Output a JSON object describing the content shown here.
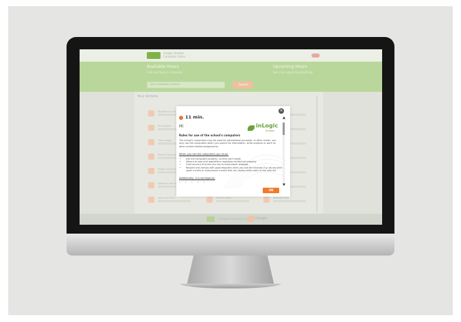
{
  "site": {
    "app_name": "inLogic Studios",
    "topbar_sub": "Computer Rules",
    "hero_title": "Available Hours",
    "hero_subtitle": "Find and book a computer",
    "hero_right_title": "Upcoming Hours",
    "hero_right_sub": "See your upcoming bookings",
    "search_placeholder": "Type a keyword to search",
    "search_button": "Search",
    "section_title": "Your Actions",
    "tiles": [
      {
        "title": "Register an hour",
        "sub": "Book a computer"
      },
      {
        "title": "Change your password",
        "sub": "Update account"
      },
      {
        "title": "My hours",
        "sub": "View schedule"
      },
      {
        "title": "Print labels",
        "sub": "Printer options"
      },
      {
        "title": "Manage help",
        "sub": "Get assistance"
      },
      {
        "title": "Show notes",
        "sub": "Notes overview"
      },
      {
        "title": "Time usage",
        "sub": "Usage summary"
      },
      {
        "title": "Print Queue",
        "sub": "Queue status"
      },
      {
        "title": "Rules",
        "sub": "Computer rules"
      },
      {
        "title": "Search Directory",
        "sub": "Find people"
      },
      {
        "title": "Messages",
        "sub": "Inbox"
      },
      {
        "title": "Settings",
        "sub": "Preferences"
      },
      {
        "title": "Usage conditions",
        "sub": "Terms"
      },
      {
        "title": "Statistics",
        "sub": "Reports"
      },
      {
        "title": "Help",
        "sub": "Support"
      },
      {
        "title": "Network Information",
        "sub": "Connection"
      },
      {
        "title": "Messages",
        "sub": "Announcements"
      },
      {
        "title": "Wireless",
        "sub": "Wi-Fi status"
      },
      {
        "title": "Administration",
        "sub": "Admin tools"
      },
      {
        "title": "Online users",
        "sub": "Who is online"
      },
      {
        "title": "Website view",
        "sub": "Public site"
      }
    ],
    "footer_text": "Computer booking system",
    "footer_brand": "inLogic"
  },
  "modal": {
    "timer": "11 min.",
    "greeting": "Hi",
    "rules_title": "Rules for use of the school's computers",
    "intro": "The school's computers may be used for educational purposes. In other words, you may use the computers when you search for information, write projects or work on other school related assignments.",
    "when_title": "When you use the computers you must:",
    "rules": [
      "Use the computers properly, so they don't break",
      "Adhere to laws and regulations regarding intellectual property",
      "Limit amount of prints you use to avoid paper wastage",
      "Respect and comply with good etiquette when you use the internet. E.g. do not send spam e-mails or anonymous e-mails that can harass other users of the internet"
    ],
    "additionally": "Additionally, it is not legal to:",
    "pager": "1 2 3 4 5",
    "ok_label": "OK",
    "close_icon": "×",
    "logo_name": "inLogic",
    "logo_sub": "Studios"
  }
}
